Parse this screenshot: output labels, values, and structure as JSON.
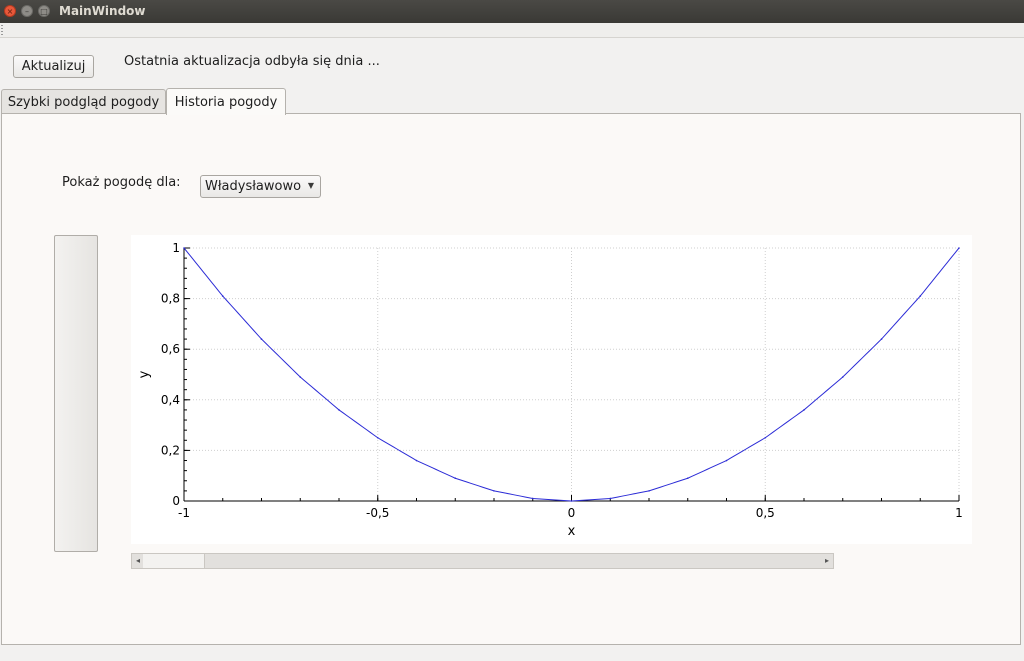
{
  "window": {
    "title": "MainWindow",
    "close_glyph": "×",
    "min_glyph": "–",
    "max_glyph": "□"
  },
  "toolbar": {
    "refresh_label": "Aktualizuj",
    "status_text": "Ostatnia aktualizacja odbyła się dnia ..."
  },
  "tabs": [
    {
      "label": "Szybki podgląd pogody",
      "active": false
    },
    {
      "label": "Historia pogody",
      "active": true
    }
  ],
  "history": {
    "city_label": "Pokaż pogodę dla:",
    "city_selected": "Władysławowo"
  },
  "scrollbar": {
    "left_arrow": "◂",
    "right_arrow": "▸"
  },
  "colors": {
    "series": "#2b2bd6",
    "grid": "#cfcfcf",
    "axis": "#000000"
  },
  "chart_data": {
    "type": "line",
    "title": "",
    "xlabel": "x",
    "ylabel": "y",
    "xlim": [
      -1,
      1
    ],
    "ylim": [
      0,
      1
    ],
    "x_ticks": [
      "-1",
      "-0,5",
      "0",
      "0,5",
      "1"
    ],
    "x_tick_values": [
      -1,
      -0.5,
      0,
      0.5,
      1
    ],
    "y_ticks": [
      "0",
      "0,2",
      "0,4",
      "0,6",
      "0,8",
      "1"
    ],
    "y_tick_values": [
      0,
      0.2,
      0.4,
      0.6,
      0.8,
      1
    ],
    "grid": true,
    "series": [
      {
        "x": [
          -1,
          -0.9,
          -0.8,
          -0.7,
          -0.6,
          -0.5,
          -0.4,
          -0.3,
          -0.2,
          -0.1,
          0,
          0.1,
          0.2,
          0.3,
          0.4,
          0.5,
          0.6,
          0.7,
          0.8,
          0.9,
          1
        ],
        "y": [
          1,
          0.81,
          0.64,
          0.49,
          0.36,
          0.25,
          0.16,
          0.09,
          0.04,
          0.01,
          0,
          0.01,
          0.04,
          0.09,
          0.16,
          0.25,
          0.36,
          0.49,
          0.64,
          0.81,
          1
        ]
      }
    ]
  }
}
